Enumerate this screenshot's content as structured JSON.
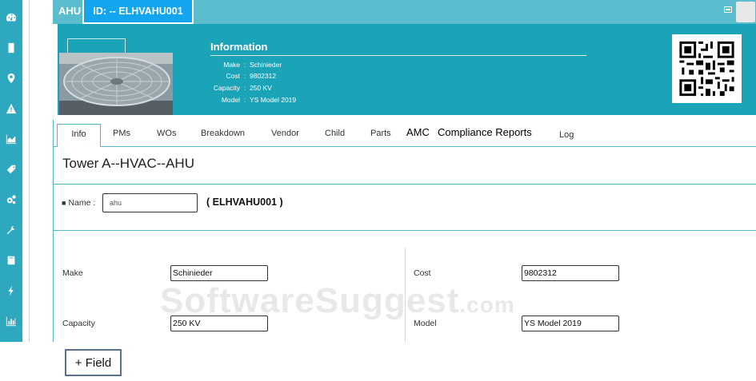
{
  "header": {
    "ahu_title": "AHU",
    "id_badge": "ID: -- ELHVAHU001"
  },
  "sidebar": {
    "items": [
      {
        "icon": "dashboard-icon"
      },
      {
        "icon": "building-icon"
      },
      {
        "icon": "location-pin-icon"
      },
      {
        "icon": "warning-icon"
      },
      {
        "icon": "area-chart-icon"
      },
      {
        "icon": "tag-icon"
      },
      {
        "icon": "gears-icon"
      },
      {
        "icon": "wrench-icon"
      },
      {
        "icon": "book-icon"
      },
      {
        "icon": "lightning-icon"
      },
      {
        "icon": "bar-chart-icon"
      }
    ]
  },
  "info": {
    "title": "Information",
    "rows": [
      {
        "key": "Make",
        "value": "Schinieder"
      },
      {
        "key": "Cost",
        "value": "9802312"
      },
      {
        "key": "Capacity",
        "value": "250 KV"
      },
      {
        "key": "Model",
        "value": "YS Model 2019"
      }
    ]
  },
  "tabs": [
    {
      "label": "Info"
    },
    {
      "label": "PMs"
    },
    {
      "label": "WOs"
    },
    {
      "label": "Breakdown"
    },
    {
      "label": "Vendor"
    },
    {
      "label": "Child"
    },
    {
      "label": "Parts"
    },
    {
      "label": "AMC"
    },
    {
      "label": "Compliance Reports"
    },
    {
      "label": "Log"
    }
  ],
  "main": {
    "path_title": "Tower A--HVAC--AHU",
    "name_label": "Name :",
    "name_value": "ahu",
    "asset_code": "( ELHVAHU001 )",
    "fields": [
      {
        "label": "Make",
        "value": "Schinieder"
      },
      {
        "label": "Cost",
        "value": "9802312"
      },
      {
        "label": "Capacity",
        "value": "250 KV"
      },
      {
        "label": "Model",
        "value": "YS Model 2019"
      }
    ]
  },
  "watermark": {
    "text": "SoftwareSuggest",
    "suffix": ".com"
  },
  "add_field_label": "+ Field",
  "colors": {
    "sidebar": "#2ea8be",
    "topbar": "#5bbccd",
    "header": "#1ba3b7",
    "id_badge": "#13a6ee",
    "accent_line": "#56b6c8",
    "button_border": "#5a6f93"
  }
}
